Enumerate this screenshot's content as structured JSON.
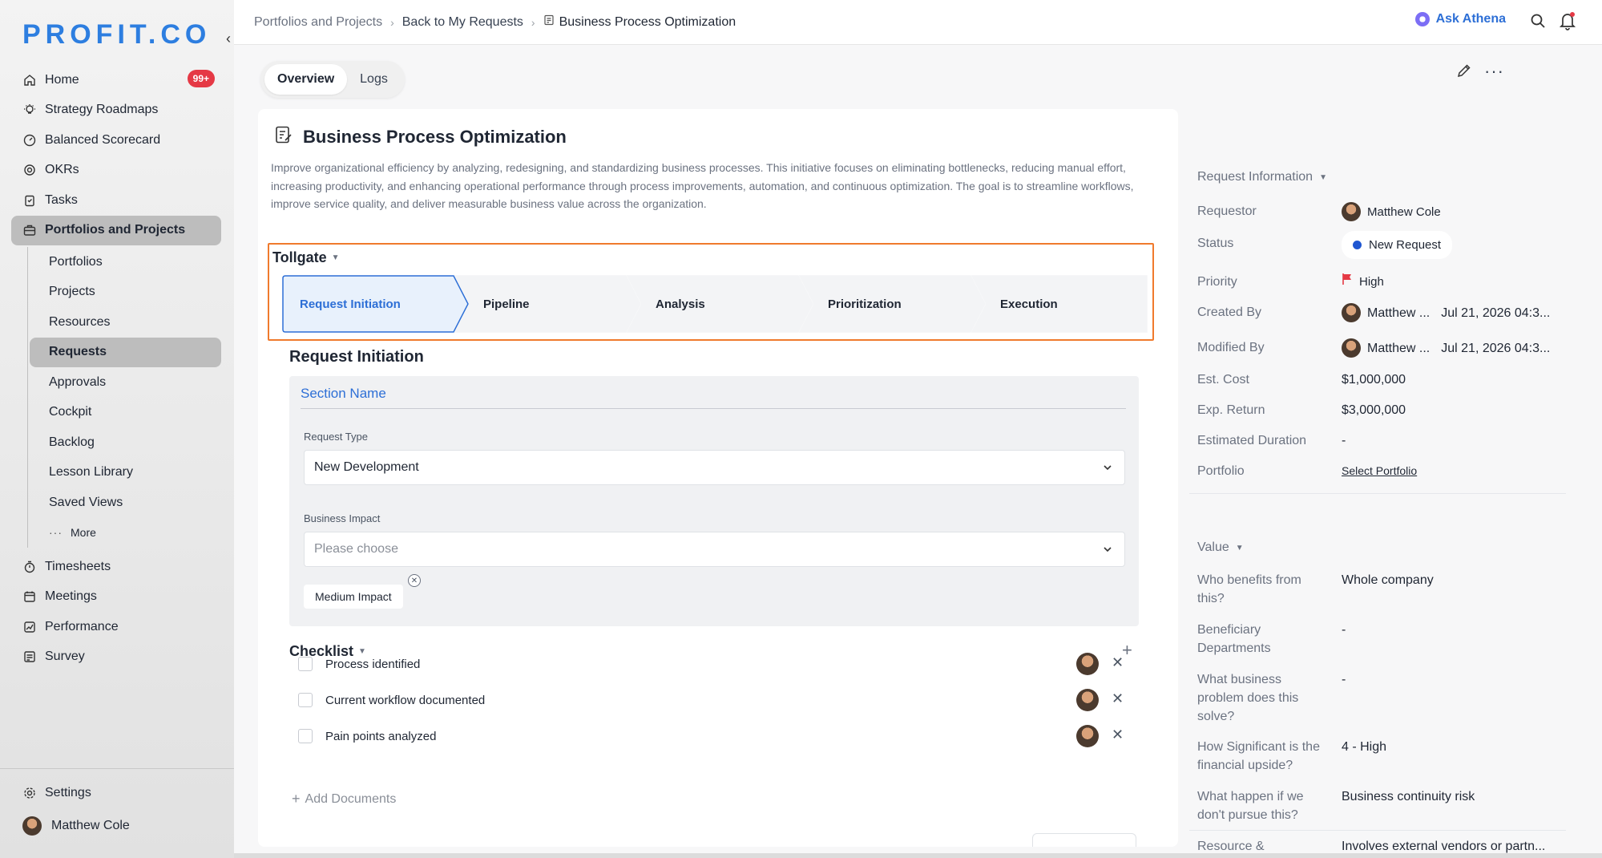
{
  "app": {
    "logo": "PROFIT.CO"
  },
  "sidebar": {
    "items": [
      {
        "label": "Home",
        "icon": "home-icon",
        "badge": "99+"
      },
      {
        "label": "Strategy Roadmaps",
        "icon": "lightbulb-icon"
      },
      {
        "label": "Balanced Scorecard",
        "icon": "scorecard-icon"
      },
      {
        "label": "OKRs",
        "icon": "target-icon"
      },
      {
        "label": "Tasks",
        "icon": "clipboard-icon"
      },
      {
        "label": "Portfolios and Projects",
        "icon": "briefcase-icon"
      }
    ],
    "subitems": [
      {
        "label": "Portfolios"
      },
      {
        "label": "Projects"
      },
      {
        "label": "Resources"
      },
      {
        "label": "Requests"
      },
      {
        "label": "Approvals"
      },
      {
        "label": "Cockpit"
      },
      {
        "label": "Backlog"
      },
      {
        "label": "Lesson Library"
      },
      {
        "label": "Saved Views"
      },
      {
        "label": "More"
      }
    ],
    "items2": [
      {
        "label": "Timesheets",
        "icon": "stopwatch-icon"
      },
      {
        "label": "Meetings",
        "icon": "calendar-icon"
      },
      {
        "label": "Performance",
        "icon": "chart-icon"
      },
      {
        "label": "Survey",
        "icon": "survey-icon"
      }
    ],
    "settings": "Settings",
    "user": "Matthew Cole"
  },
  "header": {
    "breadcrumb": [
      "Portfolios and Projects",
      "Back to My Requests",
      "Business Process Optimization"
    ],
    "ask_athena": "Ask Athena"
  },
  "tabs": [
    {
      "label": "Overview"
    },
    {
      "label": "Logs"
    }
  ],
  "request": {
    "title": "Business Process Optimization",
    "description": "Improve organizational efficiency by analyzing, redesigning, and standardizing business processes. This initiative focuses on eliminating bottlenecks, reducing manual effort, increasing productivity, and enhancing operational performance through process improvements, automation, and continuous optimization. The goal is to streamline workflows, improve service quality, and deliver measurable business value across the organization."
  },
  "tollgate": {
    "label": "Tollgate",
    "steps": [
      "Request Initiation",
      "Pipeline",
      "Analysis",
      "Prioritization",
      "Execution"
    ],
    "active_index": 0
  },
  "section": {
    "title": "Request Initiation",
    "name": "Section Name",
    "request_type_label": "Request Type",
    "request_type_value": "New Development",
    "business_impact_label": "Business Impact",
    "business_impact_placeholder": "Please choose",
    "chip": "Medium Impact"
  },
  "checklist": {
    "title": "Checklist",
    "items": [
      "Process identified",
      "Current workflow documented",
      "Pain points analyzed"
    ],
    "add_documents": "Add Documents"
  },
  "request_info": {
    "title": "Request Information",
    "requestor_label": "Requestor",
    "requestor": "Matthew Cole",
    "status_label": "Status",
    "status": "New Request",
    "status_color": "#1f56d1",
    "priority_label": "Priority",
    "priority": "High",
    "priority_color": "#e53945",
    "created_by_label": "Created By",
    "created_by": "Matthew ...",
    "created_date": "Jul 21, 2026 04:3...",
    "modified_by_label": "Modified By",
    "modified_by": "Matthew ...",
    "modified_date": "Jul 21, 2026 04:3...",
    "est_cost_label": "Est. Cost",
    "est_cost": "$1,000,000",
    "exp_return_label": "Exp. Return",
    "exp_return": "$3,000,000",
    "duration_label": "Estimated Duration",
    "duration": "-",
    "portfolio_label": "Portfolio",
    "portfolio": "Select Portfolio"
  },
  "value": {
    "title": "Value",
    "rows": [
      {
        "k": "Who benefits from this?",
        "v": "Whole company"
      },
      {
        "k": "Beneficiary Departments",
        "v": "-"
      },
      {
        "k": "What business problem does this solve?",
        "v": "-"
      },
      {
        "k": "How Significant is the financial upside?",
        "v": "4 - High"
      },
      {
        "k": "What happen if we don't pursue this?",
        "v": "Business continuity risk"
      },
      {
        "k": "Resource & Compliance",
        "v": "Involves external vendors or partn..."
      }
    ]
  }
}
